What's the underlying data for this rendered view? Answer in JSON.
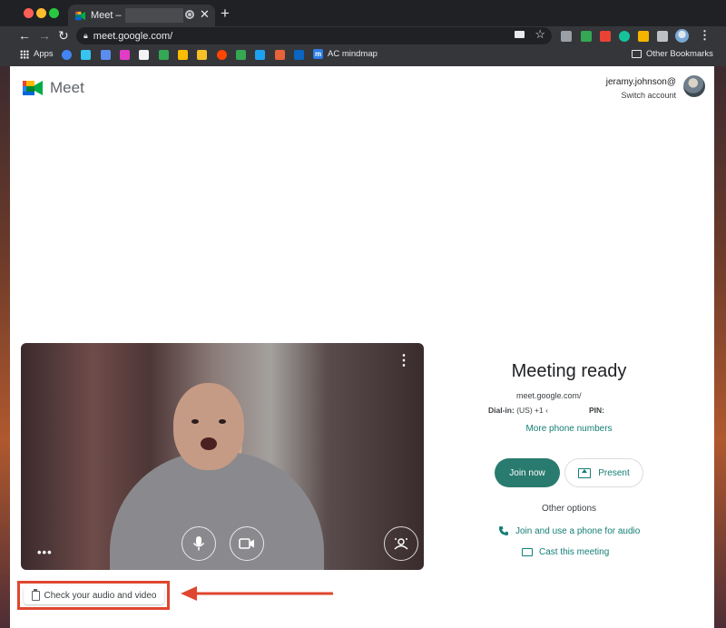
{
  "browser": {
    "tab_title": "Meet –",
    "url_visible": "meet.google.com/",
    "bookmarks": {
      "apps_label": "Apps",
      "ac_label": "AC mindmap",
      "other_label": "Other Bookmarks"
    }
  },
  "header": {
    "app_name": "Meet",
    "account_email": "jeramy.johnson@",
    "switch_account": "Switch account"
  },
  "side": {
    "title": "Meeting ready",
    "meeting_url": "meet.google.com/",
    "dialin_label": "Dial-in:",
    "dialin_value": "(US) +1 ‹",
    "pin_label": "PIN:",
    "more_numbers": "More phone numbers",
    "join_label": "Join now",
    "present_label": "Present",
    "other_options": "Other options",
    "phone_option": "Join and use a phone for audio",
    "cast_option": "Cast this meeting"
  },
  "check": {
    "label": "Check your audio and video"
  },
  "colors": {
    "accent": "#137e75",
    "join_bg": "#2a7b6f",
    "highlight": "#e0462f"
  }
}
